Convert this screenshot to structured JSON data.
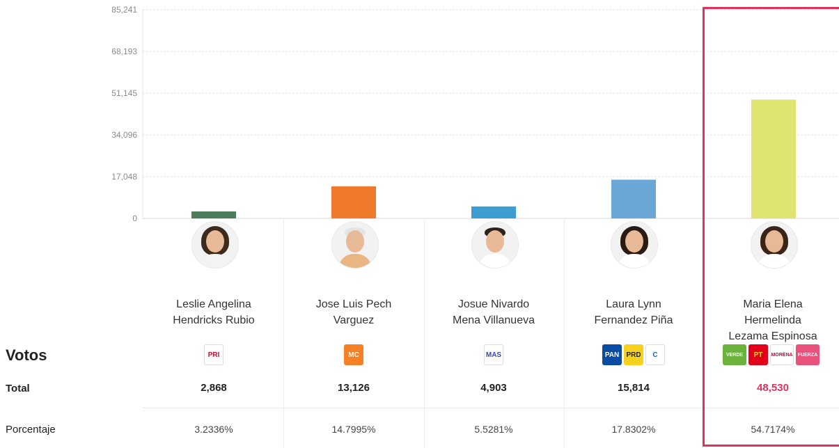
{
  "chart_data": {
    "type": "bar",
    "categories": [
      "Leslie Angelina Hendricks Rubio",
      "Jose Luis Pech Varguez",
      "Josue Nivardo Mena Villanueva",
      "Laura Lynn Fernandez Piña",
      "Maria Elena Hermelinda Lezama Espinosa"
    ],
    "values": [
      2868,
      13126,
      4903,
      15814,
      48530
    ],
    "colors": [
      "#4e7d5b",
      "#ef7a2b",
      "#3d9dd0",
      "#6aa6d6",
      "#dfe36f"
    ],
    "y_ticks": [
      "85,241",
      "68,193",
      "51,145",
      "34,096",
      "17,048",
      "0"
    ],
    "ylim": [
      0,
      85241
    ],
    "grid": true,
    "highlighted_index": 4,
    "highlight_color": "#e0325a"
  },
  "candidates": [
    {
      "name_line1": "Leslie Angelina",
      "name_line2": "Hendricks Rubio",
      "name_line3": "",
      "total": "2,868",
      "percent": "3.2336%",
      "logos": [
        {
          "text": "PRI",
          "bg": "#ffffff",
          "fg": "#c8102e"
        }
      ]
    },
    {
      "name_line1": "Jose Luis Pech",
      "name_line2": "Varguez",
      "name_line3": "",
      "total": "13,126",
      "percent": "14.7995%",
      "logos": [
        {
          "text": "MC",
          "bg": "#f58025",
          "fg": "#ffffff"
        }
      ]
    },
    {
      "name_line1": "Josue Nivardo",
      "name_line2": "Mena Villanueva",
      "name_line3": "",
      "total": "4,903",
      "percent": "5.5281%",
      "logos": [
        {
          "text": "MAS",
          "bg": "#ffffff",
          "fg": "#3b4aa0"
        }
      ]
    },
    {
      "name_line1": "Laura Lynn",
      "name_line2": "Fernandez Piña",
      "name_line3": "",
      "total": "15,814",
      "percent": "17.8302%",
      "logos": [
        {
          "text": "PAN",
          "bg": "#0a4ca3",
          "fg": "#ffffff"
        },
        {
          "text": "PRD",
          "bg": "#f6d21f",
          "fg": "#222222"
        },
        {
          "text": "C",
          "bg": "#ffffff",
          "fg": "#1a64b5"
        }
      ]
    },
    {
      "name_line1": "Maria Elena",
      "name_line2": "Hermelinda",
      "name_line3": "Lezama Espinosa",
      "total": "48,530",
      "percent": "54.7174%",
      "logos": [
        {
          "text": "VERDE",
          "bg": "#6bb33d",
          "fg": "#ffffff"
        },
        {
          "text": "PT",
          "bg": "#e3001b",
          "fg": "#f6d21f"
        },
        {
          "text": "MORENA",
          "bg": "#ffffff",
          "fg": "#b0163a"
        },
        {
          "text": "FUERZA",
          "bg": "#e8517a",
          "fg": "#ffffff"
        }
      ]
    }
  ],
  "labels": {
    "votos": "Votos",
    "total": "Total",
    "porcentaje": "Porcentaje"
  }
}
